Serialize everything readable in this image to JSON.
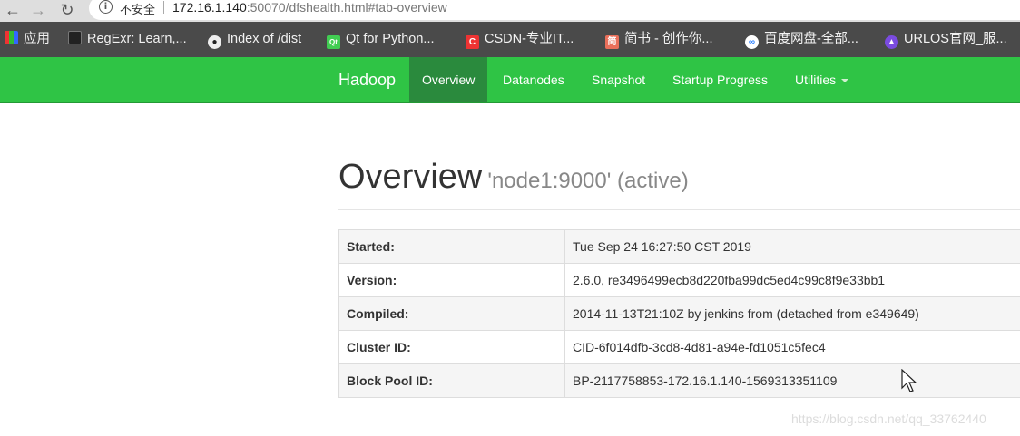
{
  "browser": {
    "address": {
      "security_label": "不安全",
      "url_host": "172.16.1.140",
      "url_rest": ":50070/dfshealth.html#tab-overview"
    },
    "bookmarks": [
      {
        "label": "应用"
      },
      {
        "label": "RegExr: Learn,..."
      },
      {
        "label": "Index of /dist"
      },
      {
        "label": "Qt for Python..."
      },
      {
        "label": "CSDN-专业IT..."
      },
      {
        "label": "简书 - 创作你..."
      },
      {
        "label": "百度网盘-全部..."
      },
      {
        "label": "URLOS官网_服..."
      }
    ]
  },
  "navbar": {
    "brand": "Hadoop",
    "items": [
      {
        "label": "Overview"
      },
      {
        "label": "Datanodes"
      },
      {
        "label": "Snapshot"
      },
      {
        "label": "Startup Progress"
      },
      {
        "label": "Utilities"
      }
    ],
    "active_color": "#2a8a3d",
    "bar_color": "#2fc445"
  },
  "page": {
    "title": "Overview",
    "subtitle": "'node1:9000' (active)"
  },
  "overview_table": [
    {
      "key": "Started:",
      "value": "Tue Sep 24 16:27:50 CST 2019"
    },
    {
      "key": "Version:",
      "value": "2.6.0, re3496499ecb8d220fba99dc5ed4c99c8f9e33bb1"
    },
    {
      "key": "Compiled:",
      "value": "2014-11-13T21:10Z by jenkins from (detached from e349649)"
    },
    {
      "key": "Cluster ID:",
      "value": "CID-6f014dfb-3cd8-4d81-a94e-fd1051c5fec4"
    },
    {
      "key": "Block Pool ID:",
      "value": "BP-2117758853-172.16.1.140-1569313351109"
    }
  ],
  "watermark": "https://blog.csdn.net/qq_33762440"
}
